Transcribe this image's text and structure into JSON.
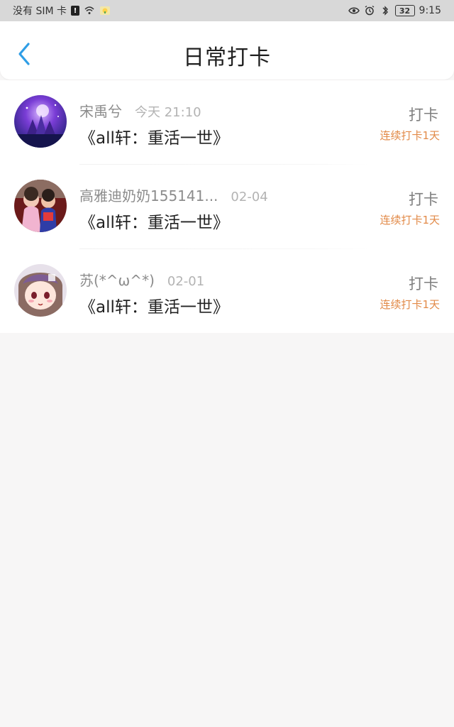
{
  "status_bar": {
    "carrier": "没有 SIM 卡",
    "battery": "32",
    "time": "9:15",
    "icons": [
      "wifi-icon",
      "alert-badge-icon",
      "notification-icon",
      "eye-icon",
      "alarm-icon",
      "bluetooth-icon",
      "battery-icon"
    ]
  },
  "header": {
    "title": "日常打卡",
    "back_icon": "chevron-left-icon"
  },
  "entries": [
    {
      "name": "宋禹兮",
      "time": "今天 21:10",
      "book": "《all轩：重活一世》",
      "status": "打卡",
      "streak": "连续打卡1天"
    },
    {
      "name": "高雅迪奶奶155141...",
      "time": "02-04",
      "book": "《all轩：重活一世》",
      "status": "打卡",
      "streak": "连续打卡1天"
    },
    {
      "name": "苏(*^ω^*)",
      "time": "02-01",
      "book": "《all轩：重活一世》",
      "status": "打卡",
      "streak": "连续打卡1天"
    }
  ],
  "colors": {
    "accent": "#2f9ee6",
    "streak": "#e28a48",
    "background": "#f7f6f6"
  }
}
